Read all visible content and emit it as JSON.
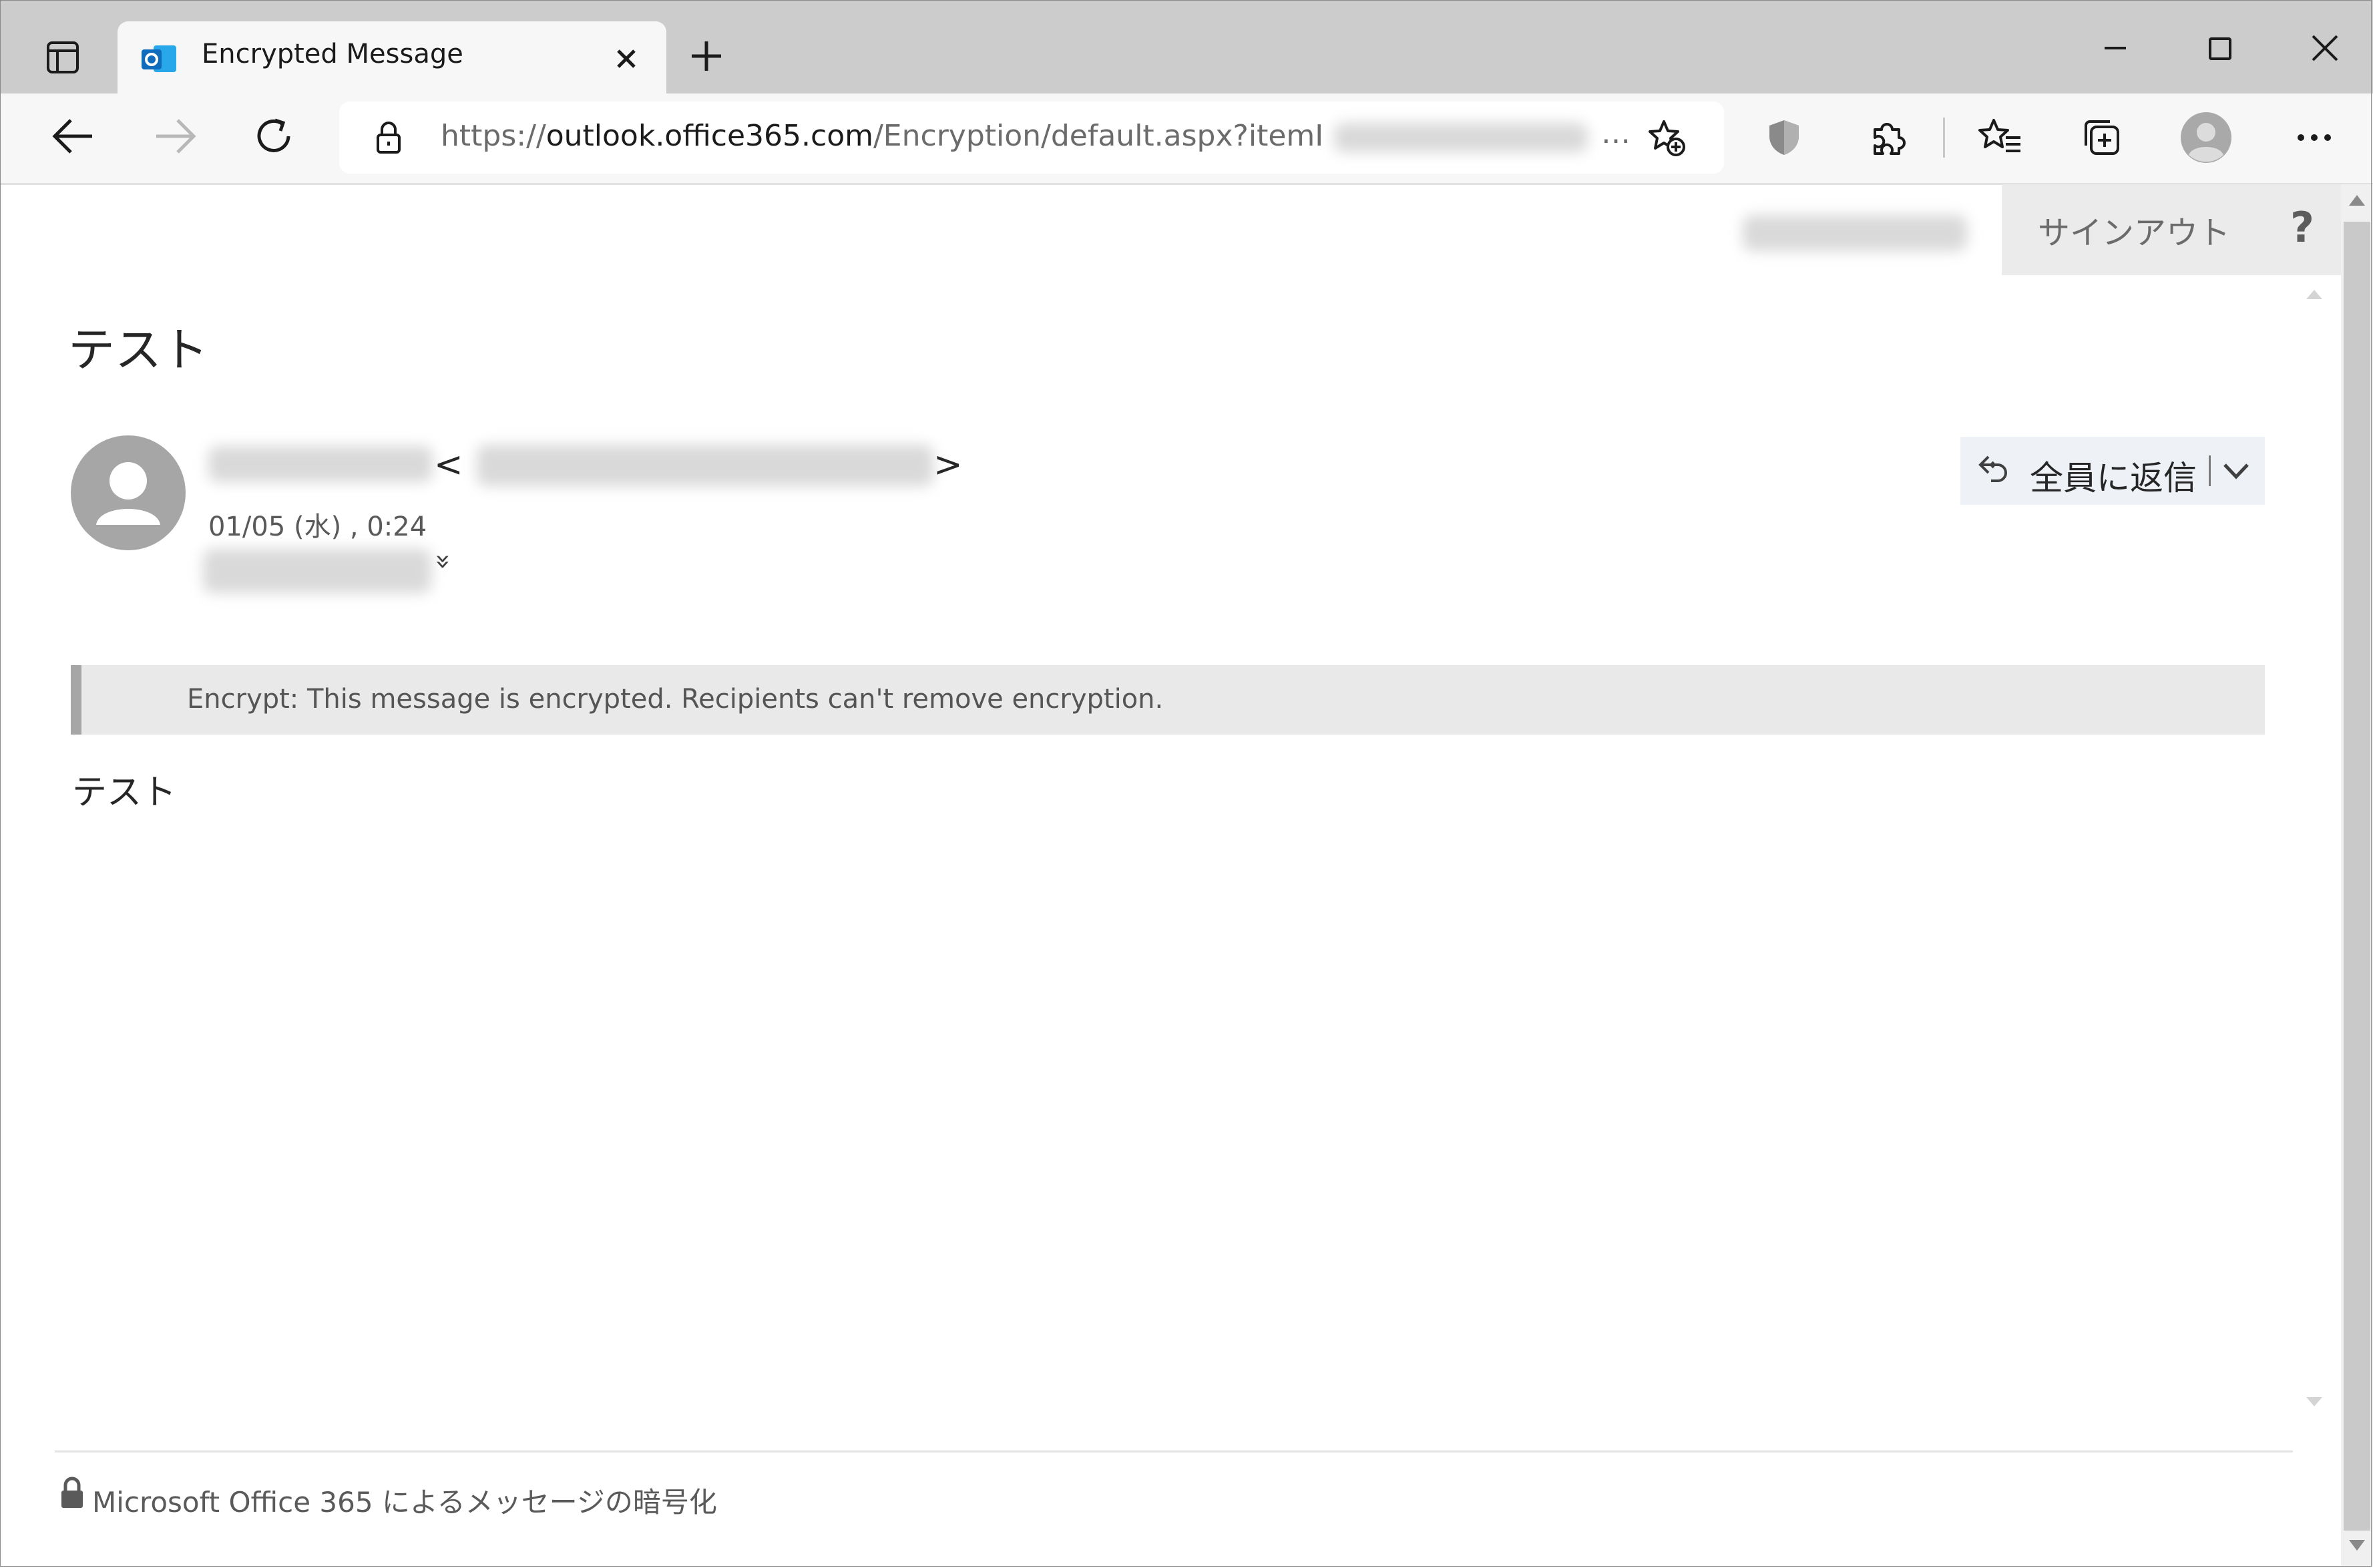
{
  "browser": {
    "tab_title": "Encrypted Message",
    "url_prefix": "https://",
    "url_host": "outlook.office365.com",
    "url_path": "/Encryption/default.aspx?itemID=",
    "url_ellipsis": "…"
  },
  "header": {
    "sign_out": "サインアウト",
    "help": "?"
  },
  "message": {
    "subject": "テスト",
    "sender_lt": "<",
    "sender_gt": ">",
    "date": "01/05 (水) , 0:24",
    "expand_glyph": "»",
    "reply_all": "全員に返信",
    "encrypt_notice": "Encrypt: This message is encrypted. Recipients can't remove encryption.",
    "body": "テスト"
  },
  "footer": {
    "text": "Microsoft Office 365 によるメッセージの暗号化"
  },
  "colors": {
    "outlook_blue": "#0f6cbd",
    "tabstrip": "#cccccc",
    "toolbar": "#f7f7f7"
  }
}
